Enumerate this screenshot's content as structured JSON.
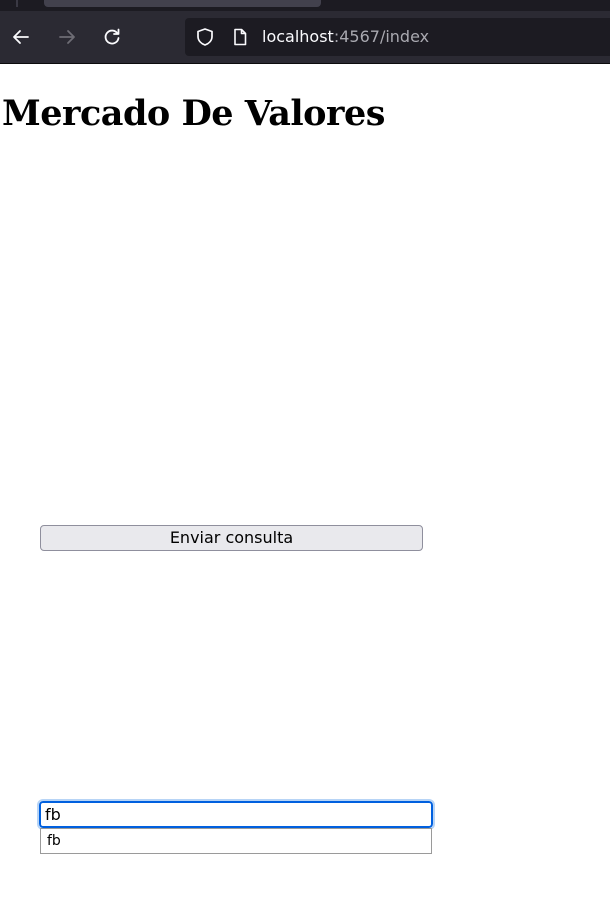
{
  "browser": {
    "url_host": "localhost",
    "url_rest": ":4567/index"
  },
  "page": {
    "title": "Mercado De Valores"
  },
  "form": {
    "submit_label": "Enviar consulta",
    "input_value": "fb"
  },
  "autocomplete": {
    "items": [
      "fb"
    ]
  },
  "colors": {
    "chrome_bg": "#2b2a33",
    "url_bar_bg": "#1c1b22",
    "focus_ring": "#0060df",
    "button_bg": "#e9e9ed"
  }
}
